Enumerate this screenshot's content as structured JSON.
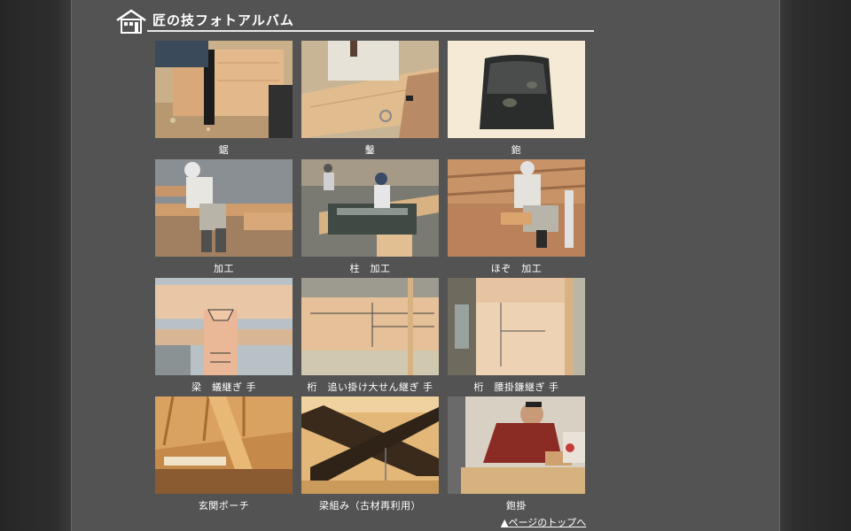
{
  "header": {
    "title": "匠の技フォトアルバム",
    "icon": "house-icon"
  },
  "photos": [
    {
      "caption": "鋸",
      "subject": "saw"
    },
    {
      "caption": "鑿",
      "subject": "chisel"
    },
    {
      "caption": "鉋",
      "subject": "plane"
    },
    {
      "caption": "加工",
      "subject": "worker-carving"
    },
    {
      "caption": "柱　加工",
      "subject": "pillar-machine"
    },
    {
      "caption": "ほぞ　加工",
      "subject": "tenon-work"
    },
    {
      "caption": "梁　蟻継ぎ 手",
      "subject": "beam-dovetail"
    },
    {
      "caption": "桁　追い掛け大せん継ぎ 手",
      "subject": "girder-joint"
    },
    {
      "caption": "桁　腰掛鎌継ぎ 手",
      "subject": "girder-kama"
    },
    {
      "caption": "玄関ポーチ",
      "subject": "porch-ceiling"
    },
    {
      "caption": "梁組み（古材再利用）",
      "subject": "old-beams"
    },
    {
      "caption": "鉋掛",
      "subject": "planing"
    }
  ],
  "footer": {
    "top_link": "▲ページのトップへ"
  },
  "colors": {
    "panel": "#535353",
    "outer": "#2a2a2a",
    "text": "#ffffff"
  }
}
